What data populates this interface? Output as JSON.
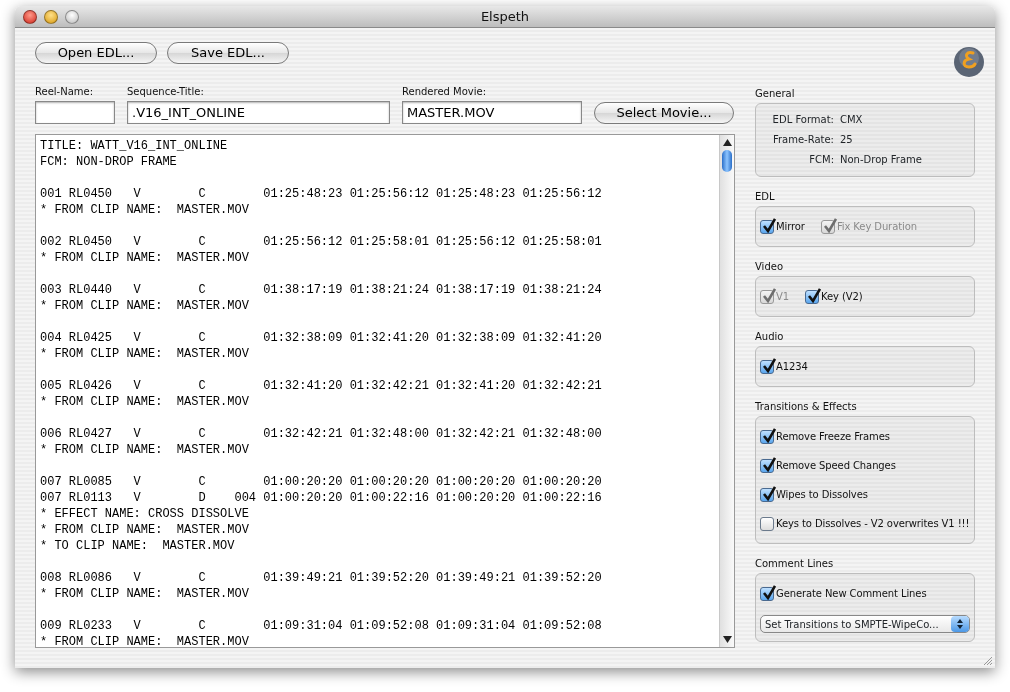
{
  "window": {
    "title": "Elspeth"
  },
  "toolbar": {
    "buttons": [
      "Open EDL...",
      "Save EDL..."
    ]
  },
  "fields": {
    "reel_name": {
      "label": "Reel-Name:"
    },
    "sequence_title": {
      "label": "Sequence-Title:",
      "value": ".V16_INT_ONLINE"
    },
    "rendered_movie": {
      "label": "Rendered Movie:",
      "value": "MASTER.MOV"
    },
    "select_button": "Select Movie..."
  },
  "edl_text": {
    "blocks": [
      [
        "TITLE: WATT_V16_INT_ONLINE",
        "FCM: NON-DROP FRAME"
      ],
      [
        "001 RL0450   V        C        01:25:48:23 01:25:56:12 01:25:48:23 01:25:56:12",
        "* FROM CLIP NAME:  MASTER.MOV"
      ],
      [
        "002 RL0450   V        C        01:25:56:12 01:25:58:01 01:25:56:12 01:25:58:01",
        "* FROM CLIP NAME:  MASTER.MOV"
      ],
      [
        "003 RL0440   V        C        01:38:17:19 01:38:21:24 01:38:17:19 01:38:21:24",
        "* FROM CLIP NAME:  MASTER.MOV"
      ],
      [
        "004 RL0425   V        C        01:32:38:09 01:32:41:20 01:32:38:09 01:32:41:20",
        "* FROM CLIP NAME:  MASTER.MOV"
      ],
      [
        "005 RL0426   V        C        01:32:41:20 01:32:42:21 01:32:41:20 01:32:42:21",
        "* FROM CLIP NAME:  MASTER.MOV"
      ],
      [
        "006 RL0427   V        C        01:32:42:21 01:32:48:00 01:32:42:21 01:32:48:00",
        "* FROM CLIP NAME:  MASTER.MOV"
      ],
      [
        "007 RL0085   V        C        01:00:20:20 01:00:20:20 01:00:20:20 01:00:20:20",
        "007 RL0113   V        D    004 01:00:20:20 01:00:22:16 01:00:20:20 01:00:22:16",
        "* EFFECT NAME: CROSS DISSOLVE",
        "* FROM CLIP NAME:  MASTER.MOV",
        "* TO CLIP NAME:  MASTER.MOV"
      ],
      [
        "008 RL0086   V        C        01:39:49:21 01:39:52:20 01:39:49:21 01:39:52:20",
        "* FROM CLIP NAME:  MASTER.MOV"
      ],
      [
        "009 RL0233   V        C        01:09:31:04 01:09:52:08 01:09:31:04 01:09:52:08",
        "* FROM CLIP NAME:  MASTER.MOV"
      ]
    ]
  },
  "panels": [
    {
      "title": "General",
      "kind": "info",
      "rows": [
        {
          "label": "EDL Format:",
          "value": "CMX"
        },
        {
          "label": "Frame-Rate:",
          "value": "25"
        },
        {
          "label": "FCM:",
          "value": "Non-Drop Frame"
        }
      ]
    },
    {
      "title": "EDL",
      "kind": "checks_row",
      "checkboxes": [
        {
          "label": "Mirror",
          "checked": true,
          "disabled": false
        },
        {
          "label": "Fix Key Duration",
          "checked": true,
          "disabled": true
        }
      ]
    },
    {
      "title": "Video",
      "kind": "checks_row",
      "checkboxes": [
        {
          "label": "V1",
          "checked": true,
          "disabled": true
        },
        {
          "label": "Key (V2)",
          "checked": true,
          "disabled": false
        }
      ]
    },
    {
      "title": "Audio",
      "kind": "checks_row",
      "checkboxes": [
        {
          "label": "A1234",
          "checked": true,
          "disabled": false
        }
      ]
    },
    {
      "title": "Transitions & Effects",
      "kind": "checks_column",
      "checkboxes": [
        {
          "label": "Remove Freeze Frames",
          "checked": true,
          "disabled": false
        },
        {
          "label": "Remove Speed Changes",
          "checked": true,
          "disabled": false
        },
        {
          "label": "Wipes to Dissolves",
          "checked": true,
          "disabled": false
        },
        {
          "label": "Keys to Dissolves - V2 overwrites V1 !!!",
          "checked": false,
          "disabled": false
        }
      ]
    },
    {
      "title": "Comment Lines",
      "kind": "checks_column",
      "checkboxes": [
        {
          "label": "Generate New Comment Lines",
          "checked": true,
          "disabled": false
        }
      ],
      "dropdown": {
        "value": "Set Transitions to SMPTE-WipeCo..."
      }
    }
  ]
}
